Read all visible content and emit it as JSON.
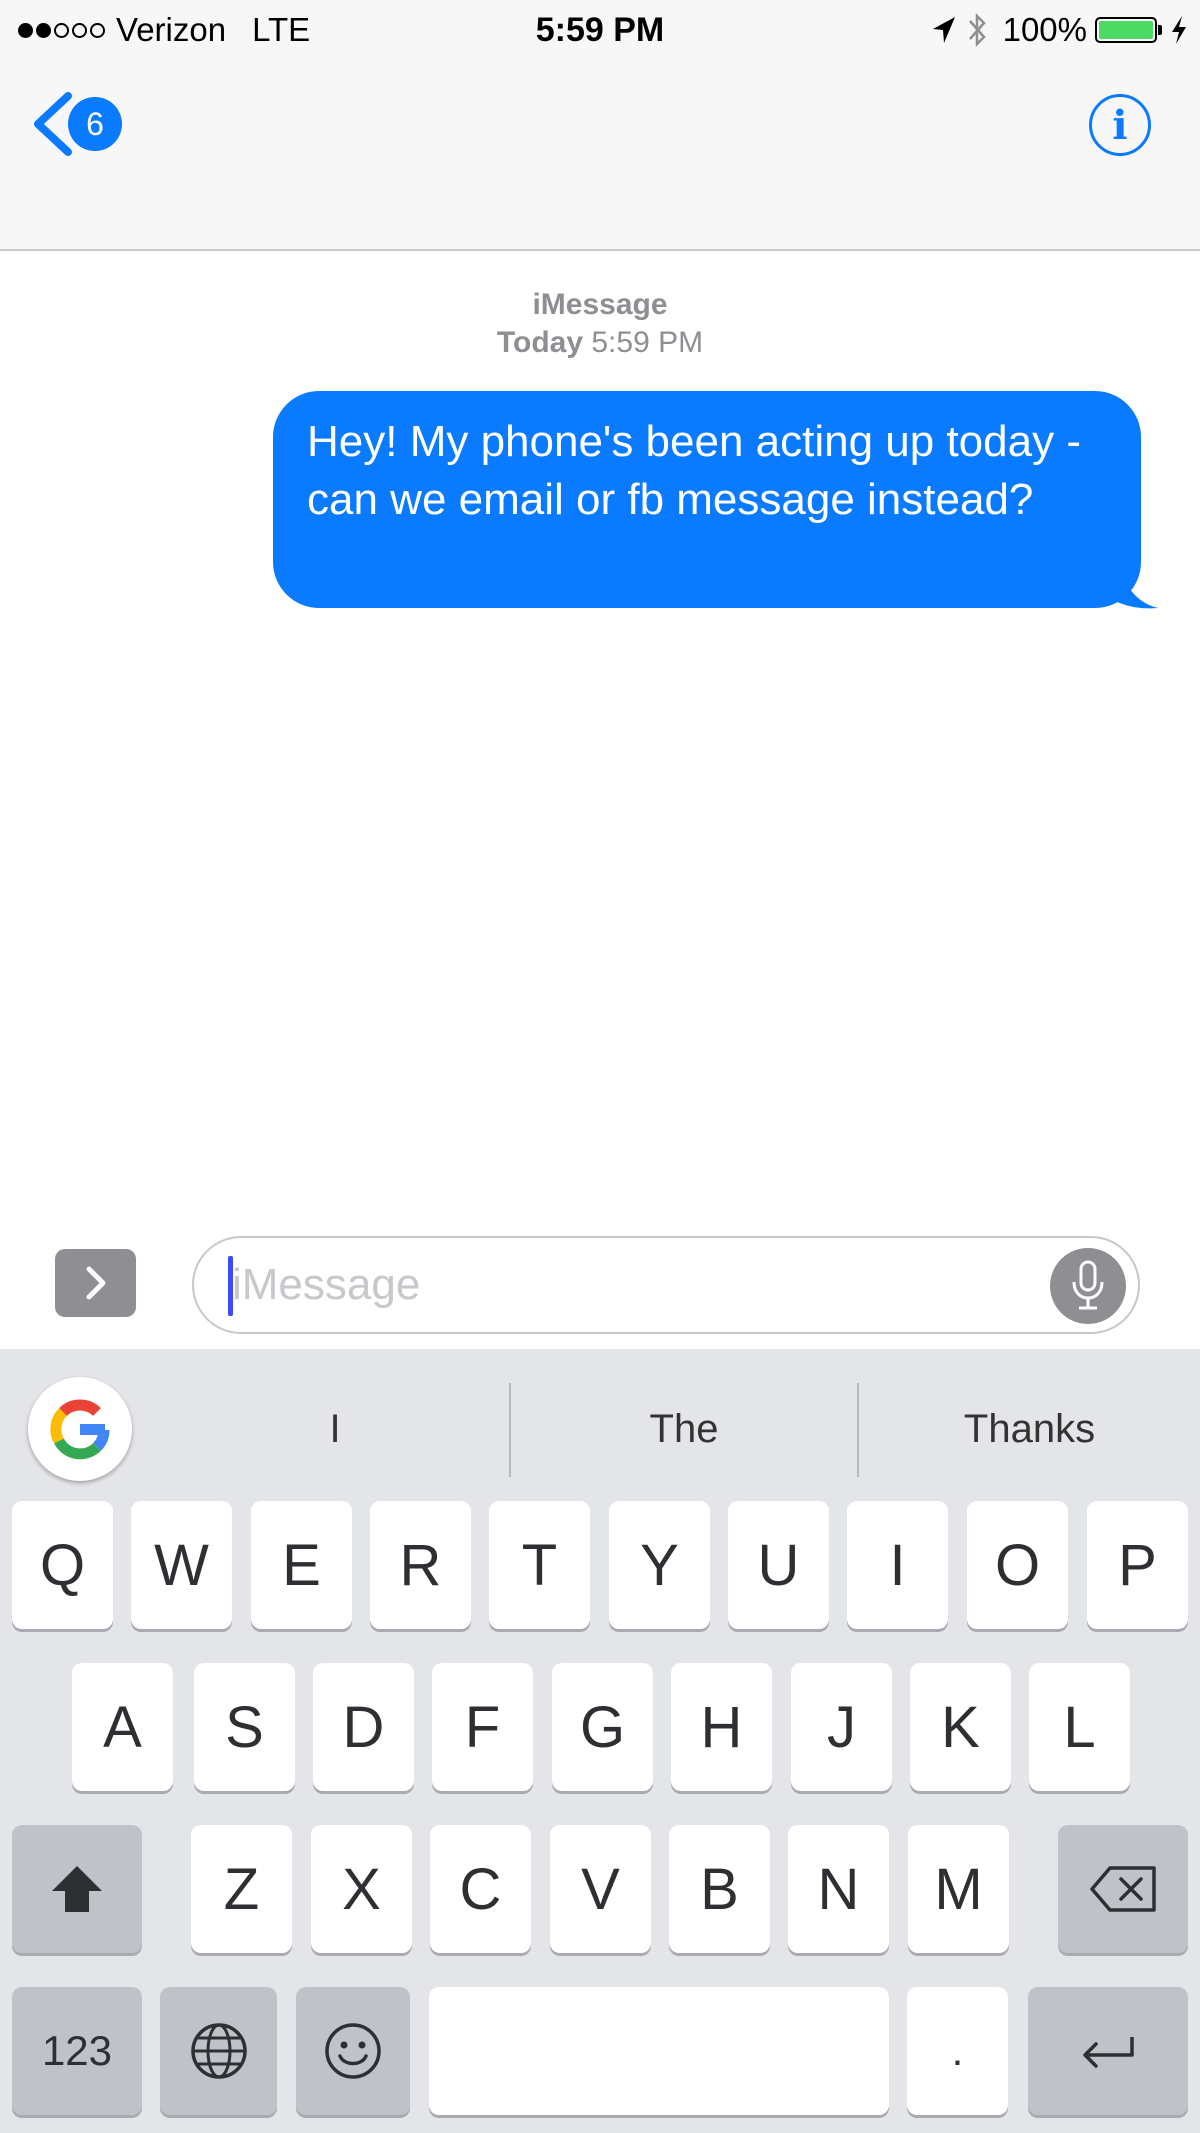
{
  "status_bar": {
    "carrier": "Verizon",
    "network": "LTE",
    "time": "5:59 PM",
    "battery": "100%",
    "battery_level": 1.0,
    "signal_bars": 2,
    "signal_total": 5
  },
  "nav": {
    "back_badge": "6",
    "info_label": "i"
  },
  "conversation": {
    "service": "iMessage",
    "day": "Today",
    "time": "5:59 PM",
    "messages": [
      {
        "direction": "outgoing",
        "text": "Hey! My phone's been acting up today - can we email or fb message instead?"
      }
    ]
  },
  "composer": {
    "placeholder": "iMessage"
  },
  "keyboard": {
    "suggestions": [
      "I",
      "The",
      "Thanks"
    ],
    "row1": [
      "Q",
      "W",
      "E",
      "R",
      "T",
      "Y",
      "U",
      "I",
      "O",
      "P"
    ],
    "row2": [
      "A",
      "S",
      "D",
      "F",
      "G",
      "H",
      "J",
      "K",
      "L"
    ],
    "row3": [
      "Z",
      "X",
      "C",
      "V",
      "B",
      "N",
      "M"
    ],
    "numbers_key": "123",
    "period_key": "."
  },
  "colors": {
    "accent": "#0a7aff",
    "battery": "#4cd964",
    "bubble": "#0a7aff",
    "keyboard_bg": "#e4e5e8"
  },
  "icons": {
    "back": "chevron-left-icon",
    "info": "info-icon",
    "apps": "chevron-right-icon",
    "mic": "microphone-icon",
    "google": "google-logo",
    "shift": "shift-icon",
    "delete": "backspace-icon",
    "globe": "globe-icon",
    "emoji": "emoji-icon",
    "return": "return-icon",
    "location": "location-arrow-icon",
    "bluetooth": "bluetooth-icon",
    "charging": "bolt-icon"
  }
}
